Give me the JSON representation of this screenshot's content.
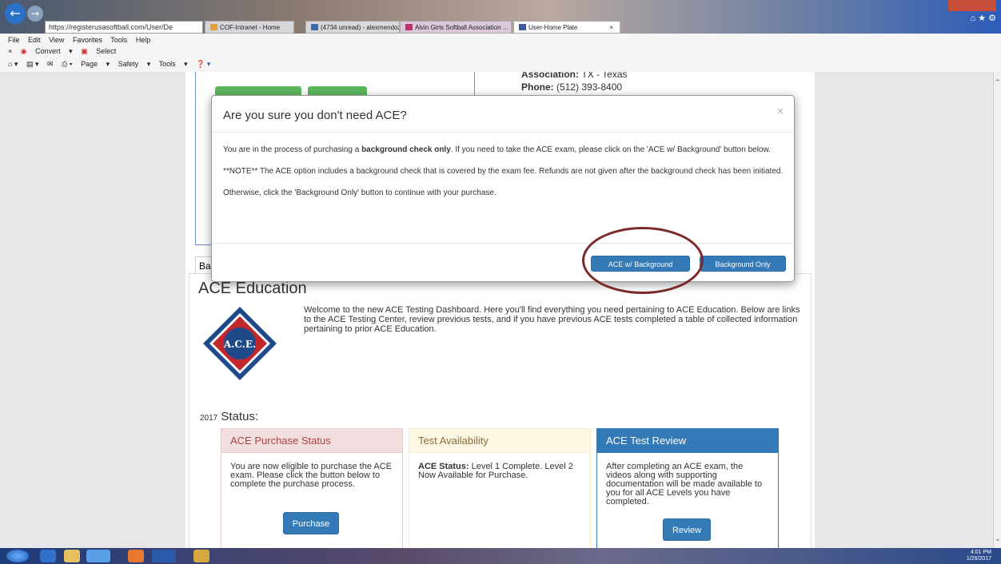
{
  "browser": {
    "address": "https://registerusasoftball.com/User/De",
    "tabs": [
      {
        "label": "COF-Intranet - Home"
      },
      {
        "label": "(4734 unread) - alexmendoza8..."
      },
      {
        "label": "Alvin Girls Softball Association ..."
      },
      {
        "label": "User-Home Plate"
      }
    ],
    "menu": [
      "File",
      "Edit",
      "View",
      "Favorites",
      "Tools",
      "Help"
    ],
    "toolbar1": [
      "Convert",
      "Select"
    ],
    "toolbar2": [
      "Page",
      "Safety",
      "Tools"
    ]
  },
  "page": {
    "association_label": "Association:",
    "association_value": "TX - Texas",
    "phone_label": "Phone:",
    "phone_value": "(512) 393-8400",
    "tab_label": "Ba",
    "ace_title": "ACE Education",
    "welcome": "Welcome to the new ACE Testing Dashboard. Here you'll find everything you need pertaining to ACE Education. Below are links to the ACE Testing Center, review previous tests, and if you have previous ACE tests completed a table of collected information pertaining to prior ACE Education.",
    "logo_text": "A.C.E.",
    "status_year": "2017",
    "status_label": "Status:",
    "cards": {
      "purchase": {
        "title": "ACE Purchase Status",
        "body": "You are now eligible to purchase the ACE exam. Please click the button below to complete the purchase process.",
        "button": "Purchase"
      },
      "availability": {
        "title": "Test Availability",
        "body_bold": "ACE Status:",
        "body": " Level 1 Complete. Level 2 Now Available for Purchase."
      },
      "review": {
        "title": "ACE Test Review",
        "body": "After completing an ACE exam, the videos along with supporting documentation will be made available to you for all ACE Levels you have completed.",
        "button": "Review"
      }
    }
  },
  "modal": {
    "title": "Are you sure you don't need ACE?",
    "close": "×",
    "p1_pre": "You are in the process of purchasing a ",
    "p1_bold": "background check only",
    "p1_post": ". If you need to take the ACE exam, please click on the 'ACE w/ Background' button below.",
    "p2": "**NOTE** The ACE option includes a background check that is covered by the exam fee. Refunds are not given after the background check has been initiated.",
    "p3": "Otherwise, click the 'Background Only' button to continue with your purchase.",
    "btn_ace": "ACE w/ Background",
    "btn_bg": "Background Only"
  },
  "taskbar": {
    "time": "4:01 PM",
    "date": "1/26/2017"
  },
  "colors": {
    "primary": "#337ab7",
    "success": "#5cb85c",
    "danger_bg": "#f2dede",
    "warning_bg": "#fcf8e3",
    "annotation": "#7b2a2a"
  }
}
